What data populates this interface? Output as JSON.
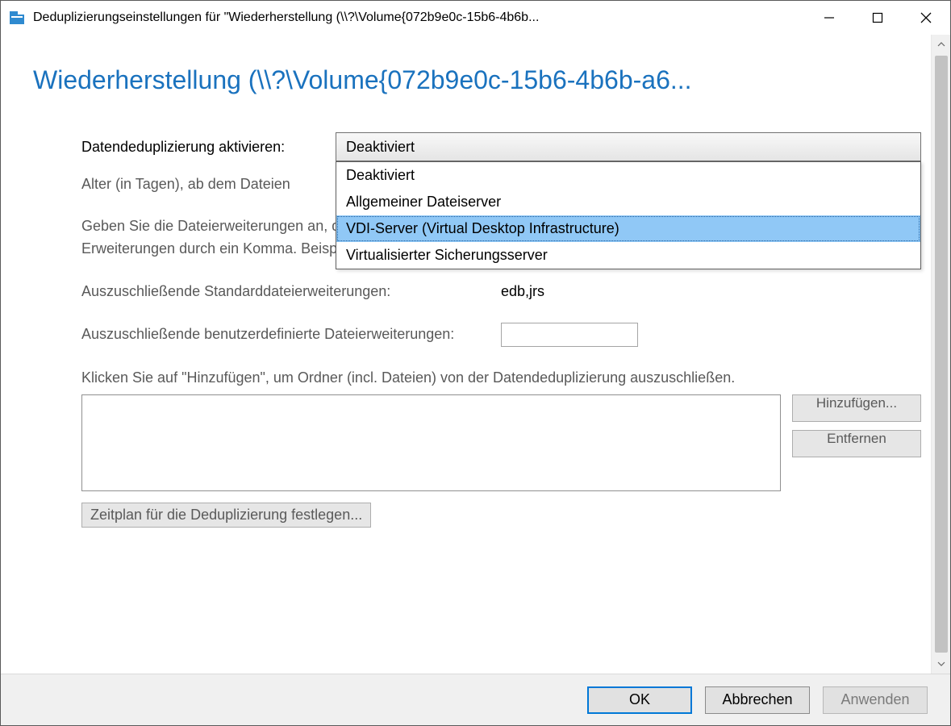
{
  "titlebar": {
    "text": "Deduplizierungseinstellungen für \"Wiederherstellung (\\\\?\\Volume{072b9e0c-15b6-4b6b..."
  },
  "page_title": "Wiederherstellung (\\\\?\\Volume{072b9e0c-15b6-4b6b-a6...",
  "labels": {
    "enable": "Datendeduplizierung aktivieren:",
    "age": "Alter (in Tagen), ab dem Dateien",
    "help": "Geben Sie die Dateierweiterungen an, die Sie von der Datendeduplizierung ausschließen möchten. Trennen Sie die Erweiterungen durch ein Komma. Beispiel: \"doc,txt,png\"",
    "default_ext": "Auszuschließende Standarddateierweiterungen:",
    "default_ext_value": "edb,jrs",
    "custom_ext": "Auszuschließende benutzerdefinierte Dateierweiterungen:",
    "folder_instruction": "Klicken Sie auf \"Hinzufügen\", um Ordner (incl. Dateien) von der Datendeduplizierung auszuschließen.",
    "schedule": "Zeitplan für die Deduplizierung festlegen..."
  },
  "combo": {
    "selected": "Deaktiviert",
    "options": [
      "Deaktiviert",
      "Allgemeiner Dateiserver",
      "VDI-Server (Virtual Desktop Infrastructure)",
      "Virtualisierter Sicherungsserver"
    ],
    "highlight_index": 2
  },
  "buttons": {
    "add": "Hinzufügen...",
    "remove": "Entfernen",
    "ok": "OK",
    "cancel": "Abbrechen",
    "apply": "Anwenden"
  }
}
